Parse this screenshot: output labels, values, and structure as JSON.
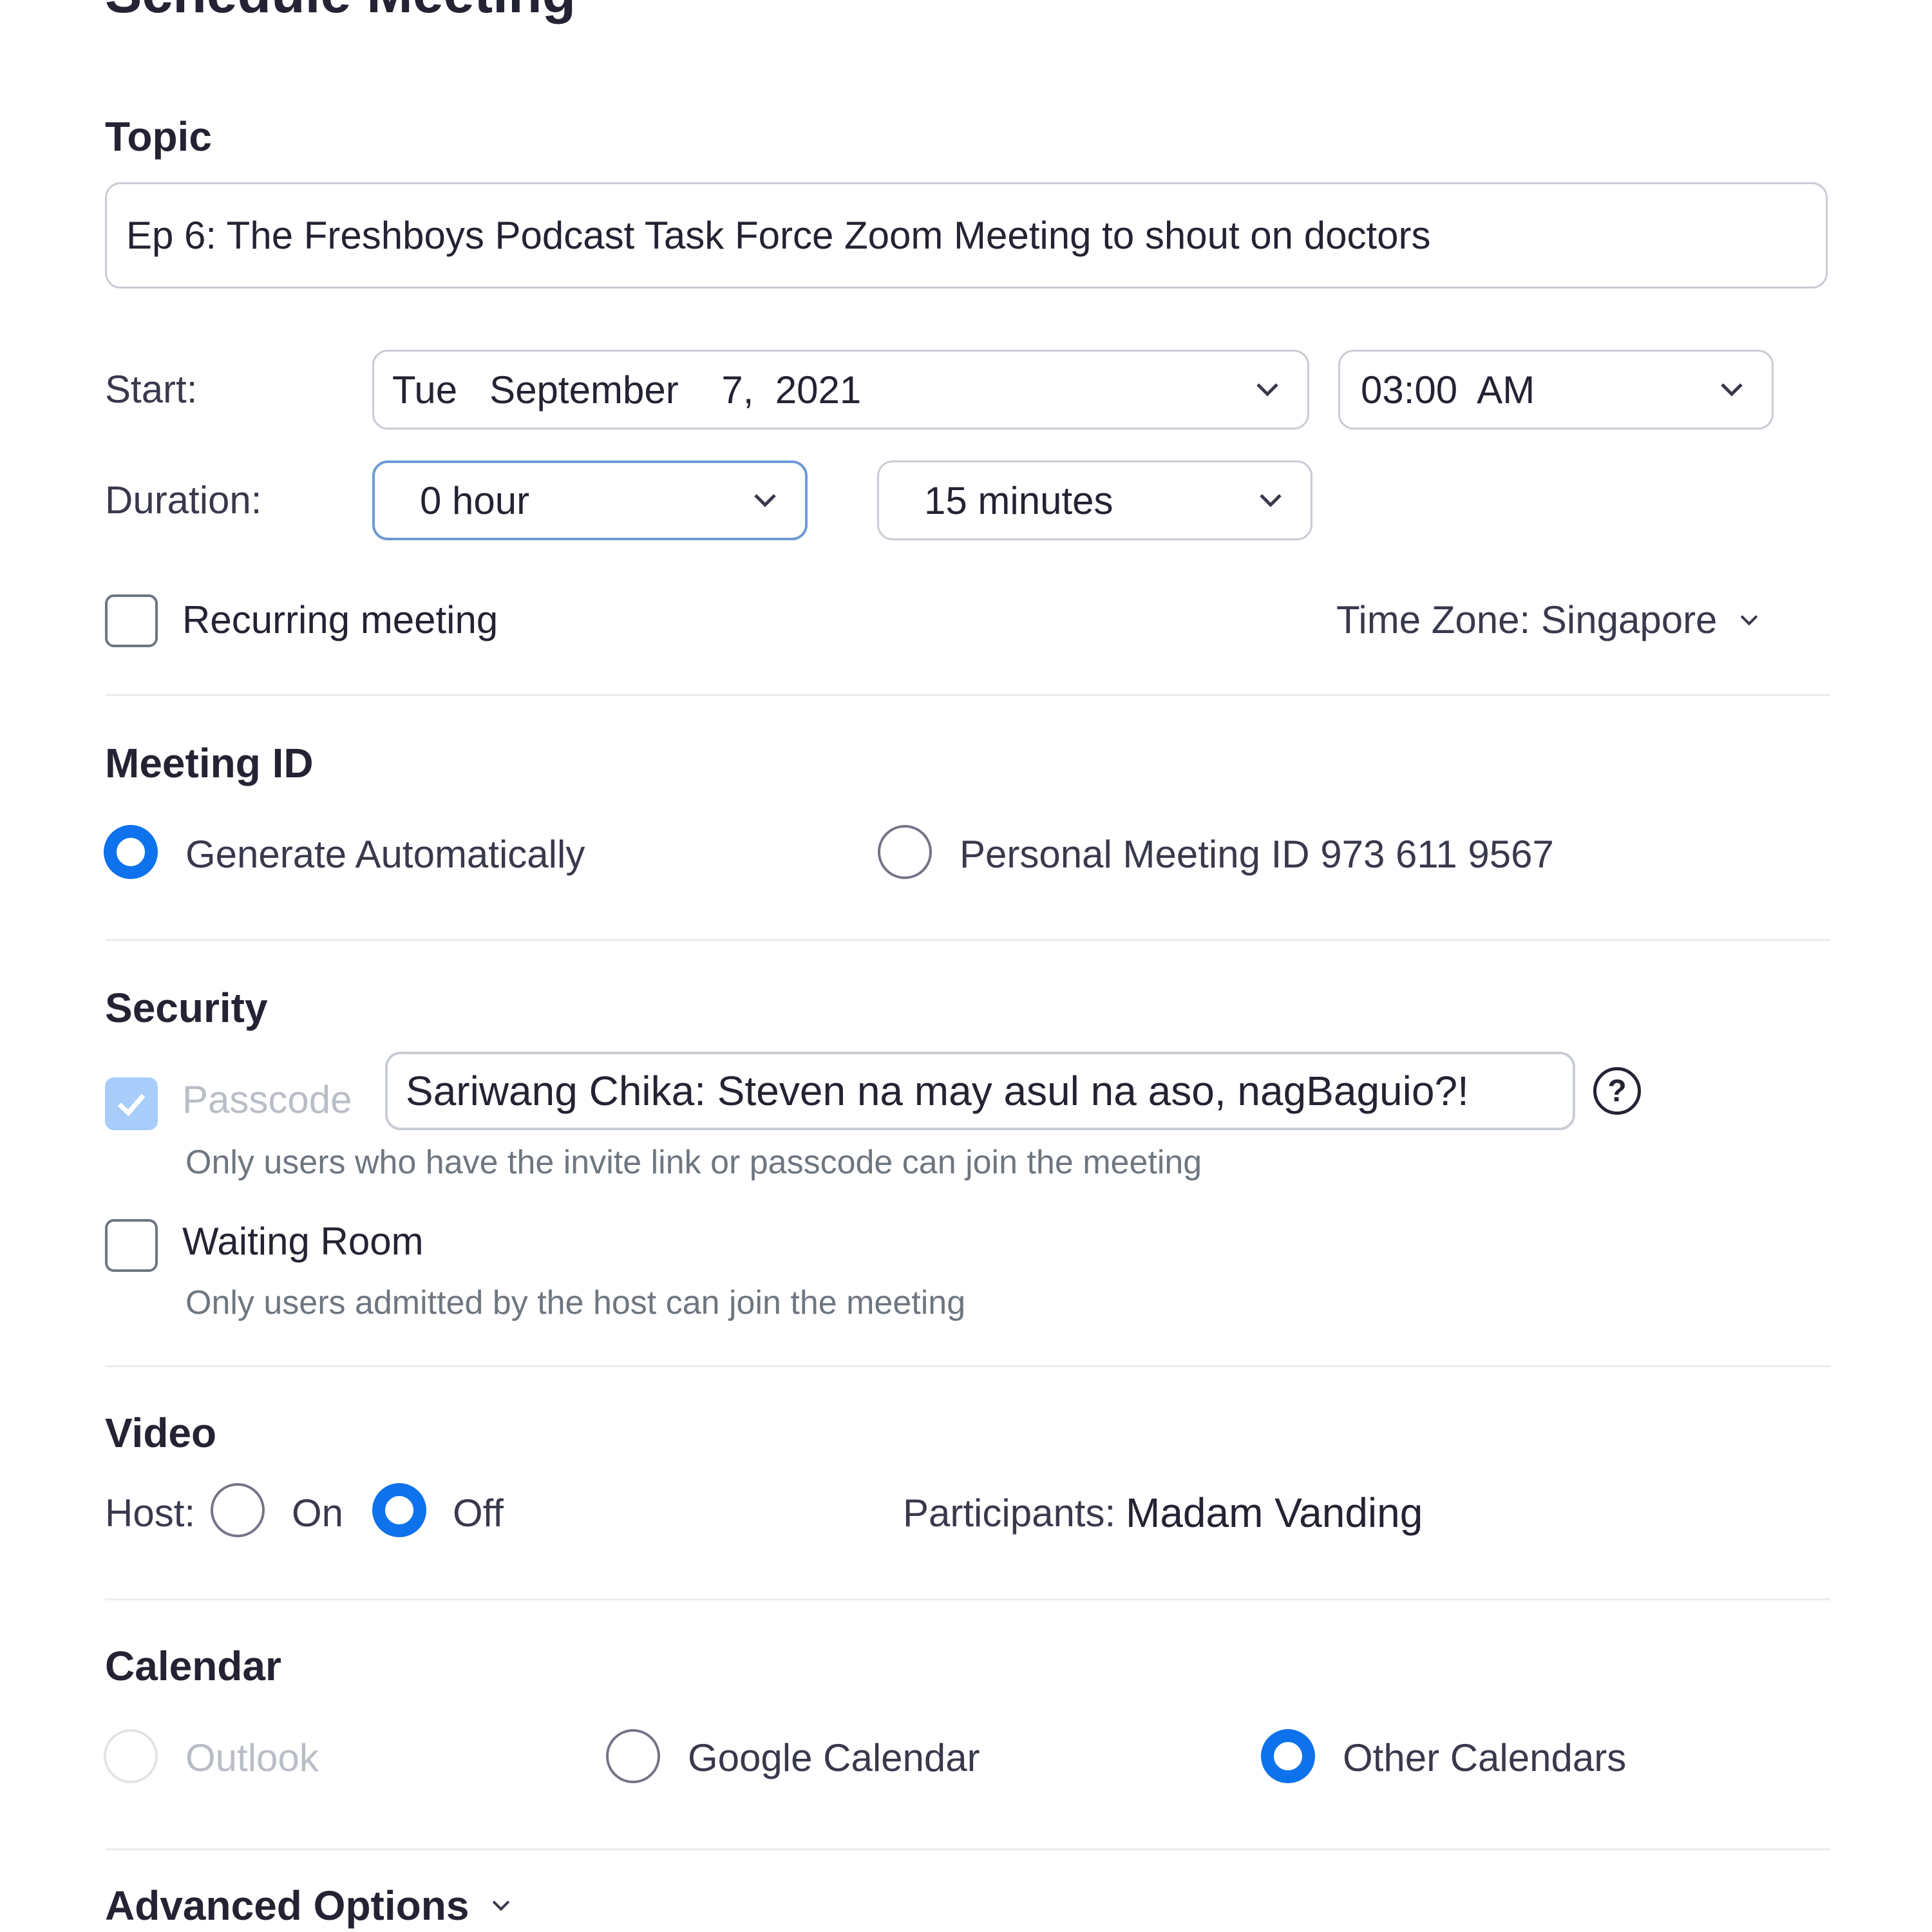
{
  "window": {
    "title": "Schedule Meeting"
  },
  "topic": {
    "heading": "Topic",
    "value": "Ep 6: The Freshboys Podcast Task Force Zoom Meeting to shout on doctors"
  },
  "start": {
    "label": "Start:",
    "date": "Tue   September    7,  2021",
    "time": "03:00  AM"
  },
  "duration": {
    "label": "Duration:",
    "hours": "0 hour",
    "minutes": "15 minutes"
  },
  "recurring": {
    "label": "Recurring meeting",
    "checked": false
  },
  "timezone": {
    "label": "Time Zone: Singapore"
  },
  "meeting_id": {
    "heading": "Meeting ID",
    "options": [
      {
        "label": "Generate Automatically",
        "selected": true
      },
      {
        "label": "Personal Meeting ID 973 611 9567",
        "selected": false
      }
    ]
  },
  "security": {
    "heading": "Security",
    "passcode": {
      "label": "Passcode",
      "value": "Sariwang Chika: Steven na may asul na aso, nagBaguio?!",
      "hint": "Only users who have the invite link or passcode can join the meeting",
      "checked": true,
      "disabled": true,
      "help_glyph": "?"
    },
    "waiting_room": {
      "label": "Waiting Room",
      "hint": "Only users admitted by the host can join the meeting",
      "checked": false
    }
  },
  "video": {
    "heading": "Video",
    "host_label": "Host:",
    "host_on": "On",
    "host_off": "Off",
    "host_selected": "Off",
    "participants_label": "Participants:",
    "participants_value": "Madam Vanding"
  },
  "calendar": {
    "heading": "Calendar",
    "options": [
      {
        "label": "Outlook",
        "selected": false,
        "disabled": true
      },
      {
        "label": "Google Calendar",
        "selected": false,
        "disabled": false
      },
      {
        "label": "Other Calendars",
        "selected": true,
        "disabled": false
      }
    ]
  },
  "advanced": {
    "label": "Advanced Options"
  },
  "icons": {
    "chevron": "chevron-down-icon",
    "check": "checkmark-icon",
    "help": "question-mark-icon"
  },
  "colors": {
    "accent": "#0e72ed",
    "disabled_check": "#a9cdfa",
    "text": "#232333",
    "muted": "#6e7680",
    "border": "#c8ccd4",
    "focus_border": "#6d9ad4"
  }
}
